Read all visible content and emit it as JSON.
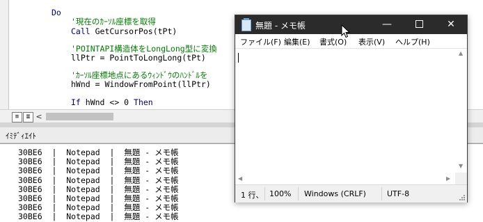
{
  "code_editor": {
    "lines": [
      {
        "kw": "Do",
        "rest": ""
      },
      {
        "comment": "'現在のｶｰｿﾙ座標を取得"
      },
      {
        "kw": "Call",
        "rest": " GetCursorPos(tPt)"
      },
      {
        "comment": "'POINTAPI構造体をLongLong型に変換"
      },
      {
        "code": "llPtr = PointToLongLong(tPt)"
      },
      {
        "comment": "'ｶｰｿﾙ座標地点にあるｳｨﾝﾄﾞｳのﾊﾝﾄﾞﾙを"
      },
      {
        "code": "hWnd = WindowFromPoint(llPtr)"
      },
      {
        "kw": "If",
        "rest": " hWnd <> 0 ",
        "kw2": "Then"
      }
    ],
    "scroll_left_arrow": "<"
  },
  "immediate": {
    "title": "ｲﾐﾃﾞｨｴｲﾄ",
    "rows": [
      "30BE6  |  Notepad  |  無題 - メモ帳",
      "30BE6  |  Notepad  |  無題 - メモ帳",
      "30BE6  |  Notepad  |  無題 - メモ帳",
      "30BE6  |  Notepad  |  無題 - メモ帳",
      "30BE6  |  Notepad  |  無題 - メモ帳",
      "30BE6  |  Notepad  |  無題 - メモ帳",
      "30BE6  |  Notepad  |  無題 - メモ帳",
      "30BE6  |  Notepad  |  無題 - メモ帳"
    ]
  },
  "notepad": {
    "title": "無題 - メモ帳",
    "controls": {
      "minimize": "—",
      "close": "✕"
    },
    "menu": [
      "ファイル(F)",
      "編集(E)",
      "書式(O)",
      "表示(V)",
      "ヘルプ(H)"
    ],
    "status": {
      "position": "1 行、1",
      "zoom": "100%",
      "line_ending": "Windows (CRLF)",
      "encoding": "UTF-8"
    },
    "scroll_arrows": {
      "up": "▲",
      "down": "▼",
      "left": "◀",
      "right": "▶"
    }
  },
  "icons": [
    "notepad-app-icon",
    "mouse-pointer-icon",
    "procedure-view-icon",
    "full-module-view-icon"
  ],
  "colors": {
    "keyword": "#00007f",
    "comment": "#007f00",
    "titlebar": "#2b2b2b"
  }
}
